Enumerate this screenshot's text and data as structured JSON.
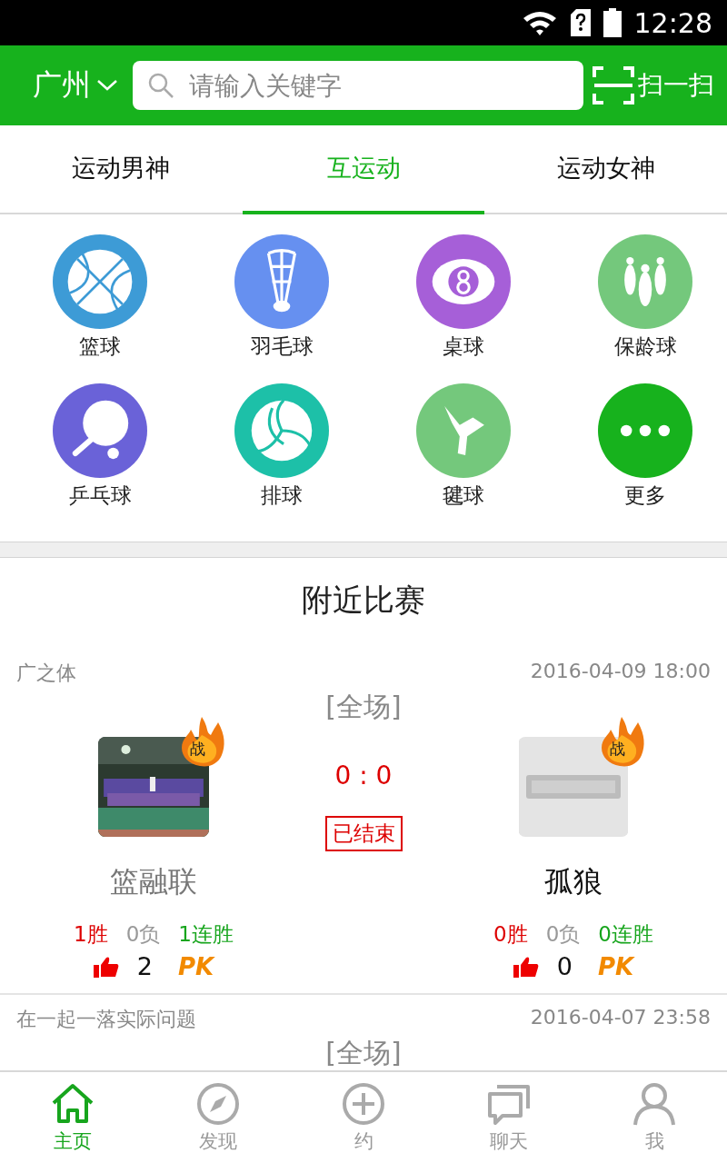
{
  "status_bar": {
    "time": "12:28"
  },
  "header": {
    "city": "广州",
    "search": {
      "placeholder": "请输入关键字"
    },
    "scan": "扫一扫"
  },
  "tabs": [
    {
      "label": "运动男神",
      "selected": false
    },
    {
      "label": "互运动",
      "selected": true
    },
    {
      "label": "运动女神",
      "selected": false
    }
  ],
  "categories": [
    {
      "label": "篮球",
      "kind": "basketball",
      "color": "#3d9bd6"
    },
    {
      "label": "羽毛球",
      "kind": "badminton",
      "color": "#6690f0"
    },
    {
      "label": "桌球",
      "kind": "billiards",
      "color": "#a65fd8"
    },
    {
      "label": "保龄球",
      "kind": "bowling",
      "color": "#74c87c"
    },
    {
      "label": "乒乓球",
      "kind": "pingpong",
      "color": "#6a62d8"
    },
    {
      "label": "排球",
      "kind": "volleyball",
      "color": "#1dc0a8"
    },
    {
      "label": "毽球",
      "kind": "shuttlecock",
      "color": "#74c87c"
    },
    {
      "label": "更多",
      "kind": "more",
      "color": "#17b21d"
    }
  ],
  "section_title": "附近比赛",
  "matches": [
    {
      "league": "广之体",
      "time": "2016-04-09 18:00",
      "period": "[全场]",
      "score": "0 : 0",
      "status": "已结束",
      "teams": [
        {
          "badge": "战",
          "name": "篮融联",
          "dimmed": true,
          "wins": "1胜",
          "losses": "0负",
          "streak": "1连胜",
          "likes": "2",
          "pk": "PK"
        },
        {
          "kind": "placeholder",
          "badge": "战",
          "name": "孤狼",
          "dimmed": false,
          "wins": "0胜",
          "losses": "0负",
          "streak": "0连胜",
          "likes": "0",
          "pk": "PK"
        }
      ]
    },
    {
      "league": "在一起一落实际问题",
      "time": "2016-04-07 23:58",
      "period": "[全场]"
    }
  ],
  "nav": [
    {
      "label": "主页",
      "kind": "home",
      "selected": true
    },
    {
      "label": "发现",
      "kind": "compass",
      "selected": false
    },
    {
      "label": "约",
      "kind": "plus",
      "selected": false
    },
    {
      "label": "聊天",
      "kind": "chat",
      "selected": false
    },
    {
      "label": "我",
      "kind": "person",
      "selected": false
    }
  ]
}
